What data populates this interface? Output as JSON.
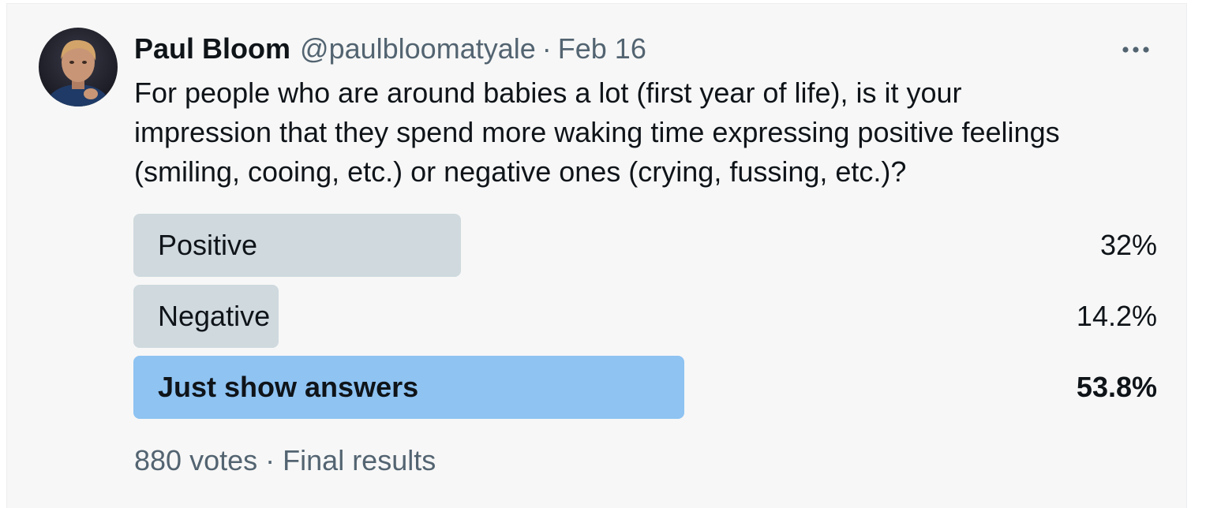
{
  "tweet": {
    "author_name": "Paul Bloom",
    "author_handle": "@paulbloomatyale",
    "separator": "·",
    "date": "Feb 16",
    "more_icon": "more-horizontal-icon",
    "avatar_icon": "profile-photo",
    "text": "For people who are around babies a lot (first year of life), is it your\nimpression that they spend more waking time expressing positive feelings\n(smiling, cooing, etc.) or negative ones (crying, fussing, etc.)?"
  },
  "poll": {
    "options": [
      {
        "label": "Positive",
        "percent_label": "32%",
        "share": 0.32,
        "winner": false
      },
      {
        "label": "Negative",
        "percent_label": "14.2%",
        "share": 0.142,
        "winner": false
      },
      {
        "label": "Just show answers",
        "percent_label": "53.8%",
        "share": 0.538,
        "winner": true
      }
    ],
    "votes": "880 votes",
    "separator": "·",
    "status": "Final results"
  },
  "colors": {
    "bar_default": "#cfd9de",
    "bar_winner": "#8ec3f2",
    "text_primary": "#0f1419",
    "text_secondary": "#536471",
    "card_background": "#f7f7f7"
  }
}
